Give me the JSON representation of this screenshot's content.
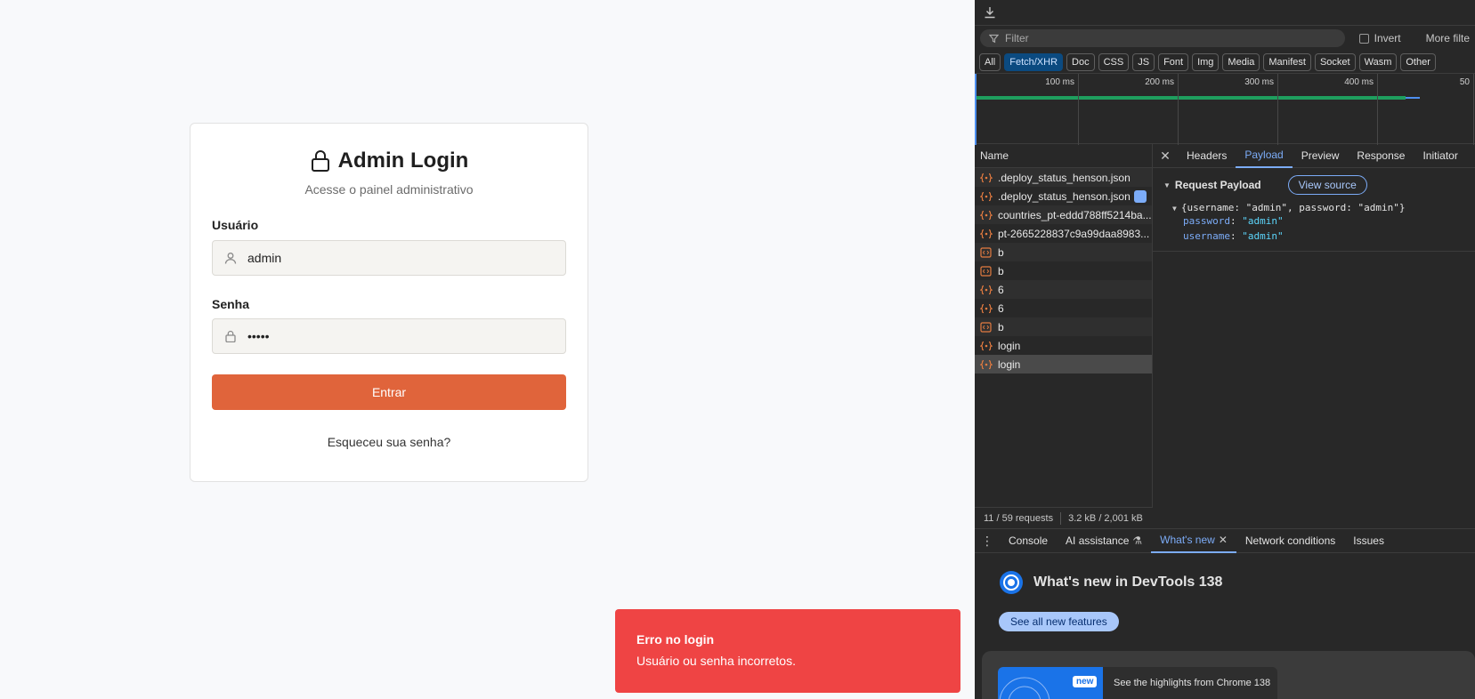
{
  "login": {
    "title": "Admin Login",
    "subtitle": "Acesse o painel administrativo",
    "username_label": "Usuário",
    "username_value": "admin",
    "password_label": "Senha",
    "password_value": "•••••",
    "submit_label": "Entrar",
    "forgot_label": "Esqueceu sua senha?"
  },
  "toast": {
    "title": "Erro no login",
    "message": "Usuário ou senha incorretos."
  },
  "devtools": {
    "filter_placeholder": "Filter",
    "invert_label": "Invert",
    "more_filters_label": "More filte",
    "type_filters": [
      "All",
      "Fetch/XHR",
      "Doc",
      "CSS",
      "JS",
      "Font",
      "Img",
      "Media",
      "Manifest",
      "Socket",
      "Wasm",
      "Other"
    ],
    "active_type_filter": "Fetch/XHR",
    "timeline_ticks": [
      "100 ms",
      "200 ms",
      "300 ms",
      "400 ms",
      "50"
    ],
    "name_header": "Name",
    "requests": [
      {
        "name": ".deploy_status_henson.json",
        "kind": "fetch"
      },
      {
        "name": ".deploy_status_henson.json",
        "kind": "fetch"
      },
      {
        "name": "countries_pt-eddd788ff5214ba...",
        "kind": "fetch"
      },
      {
        "name": "pt-2665228837c9a99daa8983...",
        "kind": "fetch"
      },
      {
        "name": "b",
        "kind": "xhr"
      },
      {
        "name": "b",
        "kind": "xhr"
      },
      {
        "name": "6",
        "kind": "fetch"
      },
      {
        "name": "6",
        "kind": "fetch"
      },
      {
        "name": "b",
        "kind": "xhr"
      },
      {
        "name": "login",
        "kind": "fetch"
      },
      {
        "name": "login",
        "kind": "fetch"
      }
    ],
    "selected_request_index": 10,
    "status_requests": "11 / 59 requests",
    "status_size": "3.2 kB / 2,001 kB",
    "detail_tabs": [
      "Headers",
      "Payload",
      "Preview",
      "Response",
      "Initiator"
    ],
    "active_detail_tab": "Payload",
    "payload_section_title": "Request Payload",
    "view_source_label": "View source",
    "payload_summary": "{username: \"admin\", password: \"admin\"}",
    "payload_fields": [
      {
        "key": "password",
        "value": "\"admin\""
      },
      {
        "key": "username",
        "value": "\"admin\""
      }
    ],
    "drawer_tabs": [
      "Console",
      "AI assistance",
      "What's new",
      "Network conditions",
      "Issues"
    ],
    "active_drawer_tab": "What's new",
    "whats_new_title": "What's new in DevTools 138",
    "see_all_label": "See all new features",
    "new_badge": "new",
    "highlights_text": "See the highlights from Chrome 138"
  },
  "colors": {
    "accent": "#e0643b",
    "error": "#ef4444",
    "devtools_bg": "#282828",
    "devtools_accent": "#7cacf8"
  }
}
